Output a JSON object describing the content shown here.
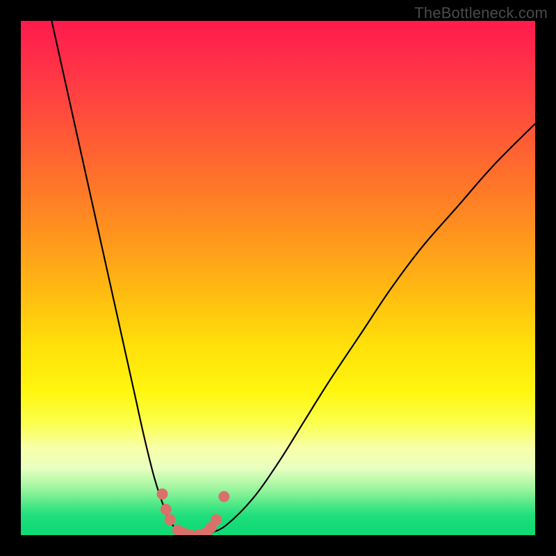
{
  "watermark": "TheBottleneck.com",
  "chart_data": {
    "type": "line",
    "title": "",
    "xlabel": "",
    "ylabel": "",
    "xlim": [
      0,
      100
    ],
    "ylim": [
      0,
      100
    ],
    "series": [
      {
        "name": "bottleneck-curve",
        "x": [
          6,
          10,
          14,
          18,
          22,
          24,
          26,
          28,
          29.5,
          31,
          33,
          35,
          37,
          40,
          45,
          50,
          55,
          60,
          66,
          72,
          78,
          85,
          92,
          100
        ],
        "values": [
          100,
          82,
          64,
          46,
          28,
          19,
          11,
          5,
          2,
          0.5,
          0,
          0,
          0.5,
          2,
          7,
          14,
          22,
          30,
          39,
          48,
          56,
          64,
          72,
          80
        ]
      }
    ],
    "markers": {
      "name": "highlight-dots",
      "color": "#d9716b",
      "points": [
        {
          "x": 27.5,
          "y": 8
        },
        {
          "x": 28.2,
          "y": 5
        },
        {
          "x": 29.0,
          "y": 3
        },
        {
          "x": 30.5,
          "y": 1
        },
        {
          "x": 31.5,
          "y": 0.5
        },
        {
          "x": 33.0,
          "y": 0
        },
        {
          "x": 34.5,
          "y": 0
        },
        {
          "x": 36.0,
          "y": 0.5
        },
        {
          "x": 37.0,
          "y": 1.5
        },
        {
          "x": 38.0,
          "y": 3
        },
        {
          "x": 39.5,
          "y": 7.5
        }
      ]
    },
    "background_gradient": {
      "top": "#ff1a4d",
      "mid": "#ffe00a",
      "bottom": "#10d976"
    }
  }
}
